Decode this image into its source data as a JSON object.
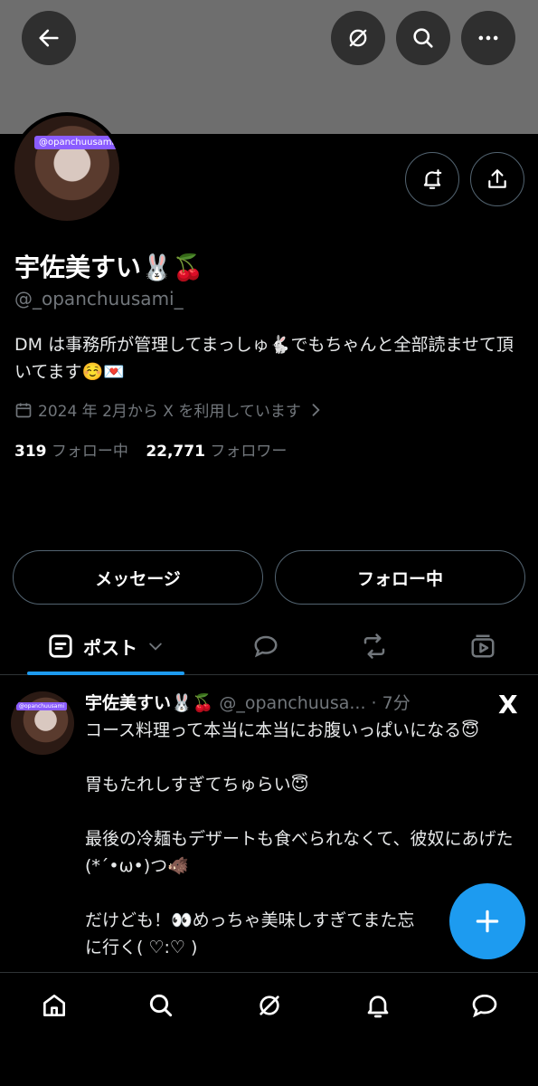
{
  "profile": {
    "avatar_tag": "@opanchuusami",
    "display_name": "宇佐美すい🐰🍒",
    "handle": "@_opanchuusami_",
    "bio": "DM は事務所が管理してまっしゅ🐇でもちゃんと全部読ませて頂いてます☺️💌",
    "joined": "2024 年 2月から X を利用しています",
    "following_count": "319",
    "following_label": "フォロー中",
    "followers_count": "22,771",
    "followers_label": "フォロワー"
  },
  "actions": {
    "message_label": "メッセージ",
    "following_button_label": "フォロー中"
  },
  "tabs": {
    "posts_label": "ポスト"
  },
  "post": {
    "avatar_tag": "@opanchuusami",
    "author_name": "宇佐美すい🐰🍒",
    "author_handle": "@_opanchuusa...",
    "time": "7分",
    "body": "コース料理って本当に本当にお腹いっぱいになる😇\n\n胃もたれしすぎてちゅらい😇\n\n最後の冷麺もデザートも食べられなくて、彼奴にあげた(*´•ω•)つ🐗\n\nだけども！👀めっちゃ美味しすぎてまた忘\nに行く( ♡:♡ )",
    "source_icon": "X"
  },
  "icons": {
    "back": "back-arrow-icon",
    "grok": "grok-icon",
    "search": "search-icon",
    "more": "more-icon",
    "notify": "bell-plus-icon",
    "share": "share-icon",
    "calendar": "calendar-icon",
    "chevron": "chevron-right-icon",
    "compose": "plus-icon"
  },
  "colors": {
    "accent": "#1d9bf0",
    "muted": "#71767b",
    "border": "#536471"
  }
}
